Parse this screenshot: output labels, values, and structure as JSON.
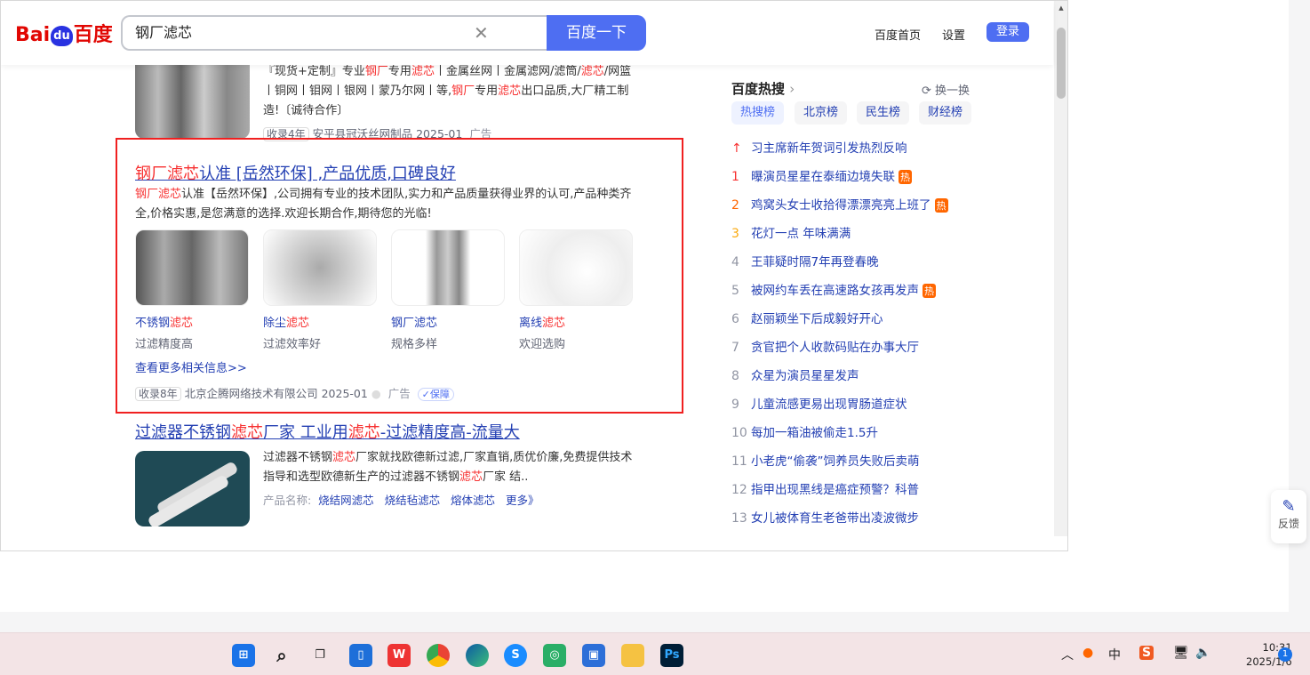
{
  "header": {
    "logo_left": "Bai",
    "logo_du": "du",
    "logo_right": "百度",
    "query": "钢厂滤芯",
    "search_button": "百度一下",
    "links": [
      "百度首页",
      "设置"
    ],
    "login": "登录"
  },
  "result0": {
    "desc": [
      "『现货+定制』专业",
      "钢厂",
      "专用",
      "滤芯",
      "丨金属丝网丨金属滤网/滤筒/",
      "滤芯",
      "/网篮丨铜网丨钼网丨银网丨蒙乃尔网丨等,",
      "钢厂",
      "专用",
      "滤芯",
      "出口品质,大厂精工制造!〔诚待合作〕"
    ],
    "tag": "收录4年",
    "source": "安平县冠沃丝网制品 2025-01",
    "ad": "广告"
  },
  "ad1": {
    "title": [
      "钢厂滤芯",
      "认准 [岳然环保] ,产品优质,口碑良好"
    ],
    "desc": [
      "钢厂滤芯",
      "认准【岳然环保】,公司拥有专业的技术团队,实力和产品质量获得业界的认可,产品种类齐全,价格实惠,是您满意的选择.欢迎长期合作,期待您的光临!"
    ],
    "cards": [
      {
        "a": "不锈钢",
        "b": "滤芯",
        "sub": "过滤精度高"
      },
      {
        "a": "除尘",
        "b": "滤芯",
        "sub": "过滤效率好"
      },
      {
        "a": "钢厂",
        "b": "滤芯",
        "sub": "规格多样"
      },
      {
        "a": "离线",
        "b": "滤芯",
        "sub": "欢迎选购"
      }
    ],
    "more": "查看更多相关信息>>",
    "tag": "收录8年",
    "source": "北京企腾网络技术有限公司 2025-01",
    "ad": "广告",
    "guarantee": "保障"
  },
  "result2": {
    "title": [
      "过滤器不锈钢",
      "滤芯",
      "厂家 工业用",
      "滤芯",
      "-过滤精度高-流量大"
    ],
    "desc": [
      "过滤器不锈钢",
      "滤芯",
      "厂家就找欧德新过滤,厂家直销,质优价廉,免费提供技术指导和选型欧德新生产的过滤器不锈钢",
      "滤芯",
      "厂家 结.."
    ],
    "products_label": "产品名称:",
    "products": [
      "烧结网滤芯",
      "烧结毡滤芯",
      "熔体滤芯",
      "更多》"
    ]
  },
  "hot": {
    "title": "百度热搜",
    "swap": "换一换",
    "tabs": [
      "热搜榜",
      "北京榜",
      "民生榜",
      "财经榜"
    ],
    "items": [
      {
        "n": "↑",
        "t": "习主席新年贺词引发热烈反响",
        "hot": ""
      },
      {
        "n": "1",
        "t": "曝演员星星在泰缅边境失联",
        "hot": "热"
      },
      {
        "n": "2",
        "t": "鸡窝头女士收拾得漂漂亮亮上班了",
        "hot": "热"
      },
      {
        "n": "3",
        "t": "花灯一点 年味满满",
        "hot": ""
      },
      {
        "n": "4",
        "t": "王菲疑时隔7年再登春晚",
        "hot": ""
      },
      {
        "n": "5",
        "t": "被网约车丢在高速路女孩再发声",
        "hot": "热"
      },
      {
        "n": "6",
        "t": "赵丽颖坐下后成毅好开心",
        "hot": ""
      },
      {
        "n": "7",
        "t": "贪官把个人收款码贴在办事大厅",
        "hot": ""
      },
      {
        "n": "8",
        "t": "众星为演员星星发声",
        "hot": ""
      },
      {
        "n": "9",
        "t": "儿童流感更易出现胃肠道症状",
        "hot": ""
      },
      {
        "n": "10",
        "t": "每加一箱油被偷走1.5升",
        "hot": ""
      },
      {
        "n": "11",
        "t": "小老虎“偷袭”饲养员失败后卖萌",
        "hot": ""
      },
      {
        "n": "12",
        "t": "指甲出现黑线是癌症预警？科普",
        "hot": ""
      },
      {
        "n": "13",
        "t": "女儿被体育生老爸带出凌波微步",
        "hot": ""
      }
    ]
  },
  "feedback": "反馈",
  "taskbar": {
    "ime": "中",
    "time": "10:31",
    "date": "2025/1/6",
    "notifications": "1",
    "ps": "Ps"
  }
}
